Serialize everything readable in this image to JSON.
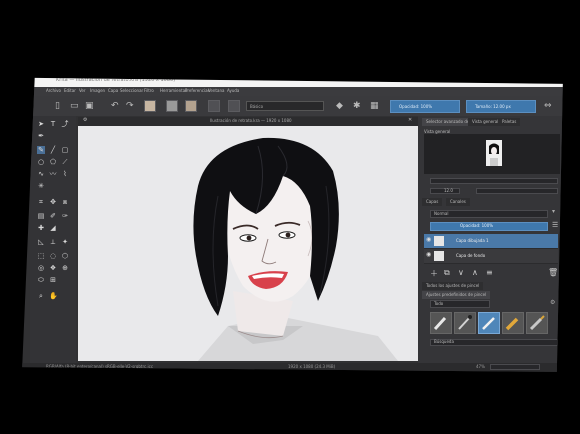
{
  "app": {
    "title": "Krita — Ilustración de retrato.kra (1920 x 1080)"
  },
  "menu": [
    "Archivo",
    "Editar",
    "Ver",
    "Imagen",
    "Capa",
    "Seleccionar",
    "Filtro",
    "Herramientas",
    "Preferencias",
    "Ventana",
    "Ayuda"
  ],
  "toolbar": {
    "brush_preset": "Básico",
    "opacity_field": "Opacidad: 100%",
    "size_field": "Tamaño: 12.00 px"
  },
  "document_tab": "Ilustración de retrato.kra — 1920 x 1080",
  "dock": {
    "tabs": [
      "Selector avanzado de color",
      "Vista general",
      "Paletas"
    ],
    "overview_label": "Vista general",
    "zoom_value": "12.0",
    "blend_mode": "Normal",
    "opacity_label": "Opacidad: 100%",
    "layers": [
      {
        "name": "Capa dibujada 1",
        "selected": true
      },
      {
        "name": "Capa de fondo"
      }
    ],
    "brush_tab_a": "Todos los ajustes de pincel",
    "brush_tab_b": "Ajustes predefinidos de pincel",
    "brush_filter": "Todo",
    "brush_search": "Búsqueda"
  },
  "status": {
    "left": "RGB/Alfa (8-bit entero/canal) sRGB-elle-V2-srgbtrc.icc",
    "mid": "1920 x 1080 (24.3 MiB)",
    "right": "47%"
  },
  "colors": {
    "accent": "#3f78ad",
    "selected_layer": "#4a79a8",
    "canvas": "#e8e8ea",
    "hair": "#0f0f12",
    "lips": "#d8414b",
    "skin": "#f3efef"
  }
}
